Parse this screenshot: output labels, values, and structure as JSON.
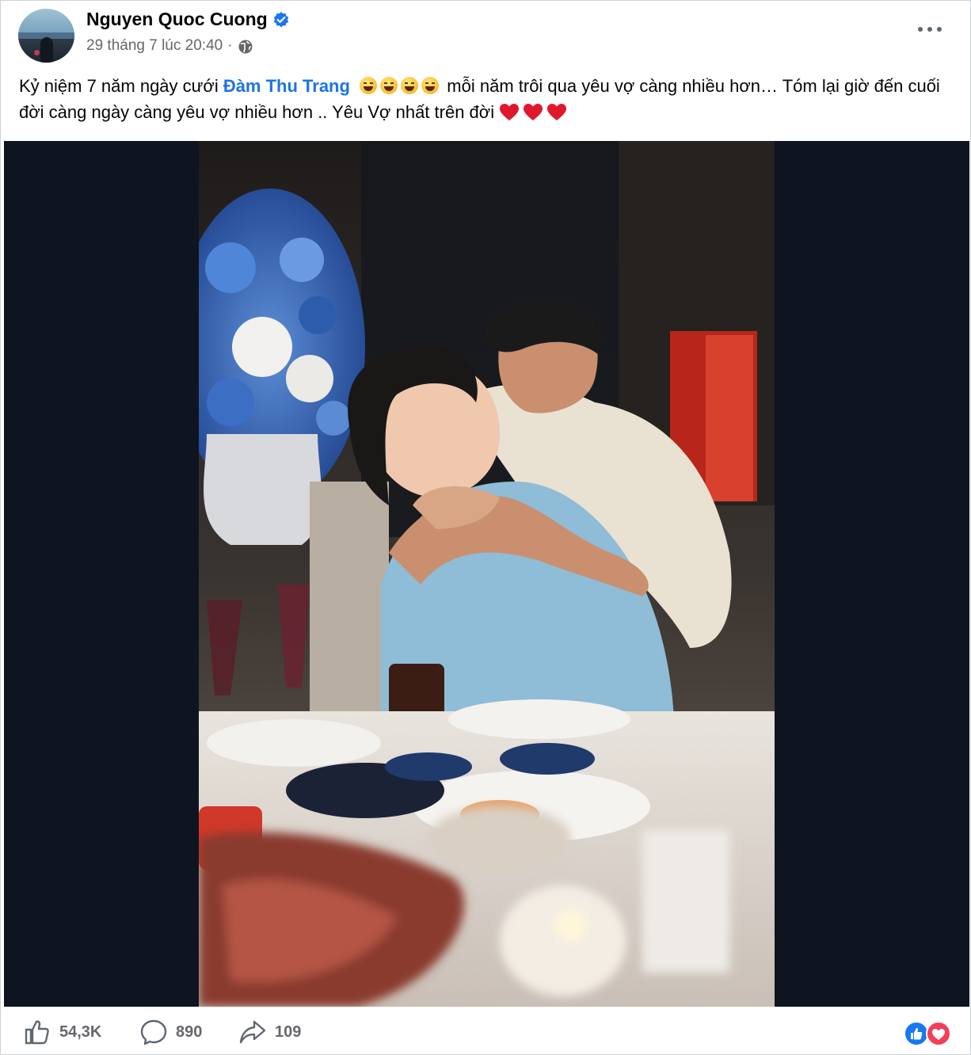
{
  "post": {
    "author": "Nguyen Quoc Cuong",
    "verified": true,
    "timestamp": "29 tháng 7 lúc 20:40",
    "separator": "·",
    "audience_icon": "globe-icon",
    "caption_parts": {
      "before_mention": "Kỷ niệm 7 năm ngày cưới ",
      "mention": "Đàm Thu Trang",
      "after_emojis": " mỗi năm trôi qua yêu vợ càng nhiều hơn… Tóm lại giờ đến cuối đời càng ngày càng yêu vợ nhiều hơn .. Yêu Vợ nhất trên đời"
    },
    "caption_emojis": [
      "grinning-face-emoji",
      "grinning-sweat-emoji",
      "smiling-sweat-emoji",
      "winking-tongue-emoji"
    ],
    "caption_hearts": [
      "red-heart-emoji",
      "red-heart-emoji",
      "red-heart-emoji"
    ]
  },
  "stats": {
    "likes": "54,3K",
    "comments": "890",
    "shares": "109"
  },
  "icons": {
    "like": "thumbs-up-icon",
    "comment": "comment-bubble-icon",
    "share": "share-arrow-icon",
    "more": "more-options-icon",
    "reactions": [
      "like-reaction-icon",
      "love-reaction-icon"
    ]
  },
  "colors": {
    "mention": "#1b74e4",
    "verified": "#1877f2",
    "photo_letterbox": "#0e1520",
    "heart": "#e0182d"
  }
}
